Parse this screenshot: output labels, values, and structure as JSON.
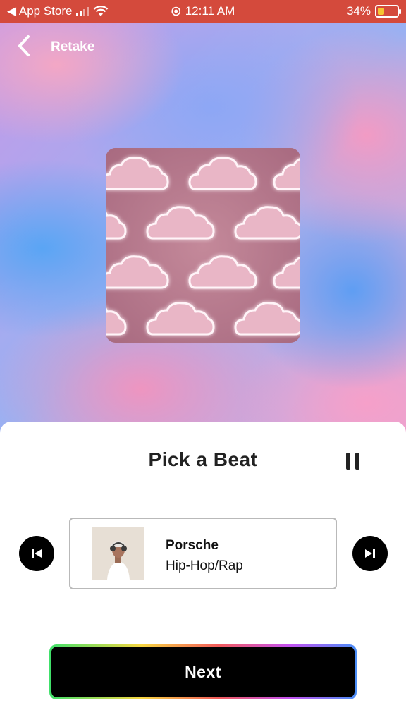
{
  "status_bar": {
    "back_app": "◀ App Store",
    "time": "12:11 AM",
    "battery": "34%",
    "battery_level": 0.34
  },
  "header": {
    "back_icon": "chevron-left-icon",
    "retake_label": "Retake"
  },
  "artwork": {
    "description_icon": "neon-clouds-artwork"
  },
  "picker": {
    "title": "Pick a Beat",
    "pause_icon": "pause-icon",
    "prev_icon": "skip-previous-icon",
    "next_icon": "skip-next-icon",
    "track": {
      "name": "Porsche",
      "genre": "Hip-Hop/Rap"
    }
  },
  "cta": {
    "next_label": "Next"
  },
  "colors": {
    "status_bar": "#d44a3c",
    "button": "#000000",
    "battery_fill": "#f6c531"
  }
}
